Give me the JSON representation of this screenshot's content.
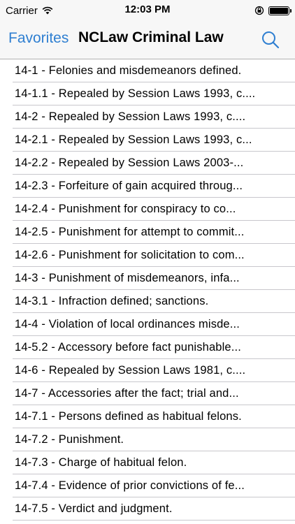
{
  "status_bar": {
    "carrier": "Carrier",
    "time": "12:03 PM"
  },
  "nav": {
    "back_label": "Favorites",
    "title": "NCLaw Criminal Law",
    "search_icon": "search-icon",
    "accent_color": "#2f7fd1"
  },
  "items": [
    "14-1 - Felonies and misdemeanors defined.",
    "14-1.1 - Repealed by Session Laws 1993, c....",
    "14-2 - Repealed by Session Laws 1993, c....",
    "14-2.1 - Repealed by Session Laws 1993, c...",
    "14-2.2 - Repealed by Session Laws 2003-...",
    "14-2.3 - Forfeiture of gain acquired throug...",
    "14-2.4 - Punishment for conspiracy to co...",
    "14-2.5 - Punishment for attempt to commit...",
    "14-2.6 - Punishment for solicitation to com...",
    "14-3 - Punishment of misdemeanors, infa...",
    "14-3.1 - Infraction defined; sanctions.",
    "14-4 - Violation of local ordinances misde...",
    "14-5.2 - Accessory before fact punishable...",
    "14-6 - Repealed by Session Laws 1981, c....",
    "14-7 - Accessories after the fact; trial and...",
    "14-7.1 - Persons defined as habitual felons.",
    "14-7.2 - Punishment.",
    "14-7.3 - Charge of habitual felon.",
    "14-7.4 - Evidence of prior convictions of fe...",
    "14-7.5 - Verdict and judgment."
  ]
}
